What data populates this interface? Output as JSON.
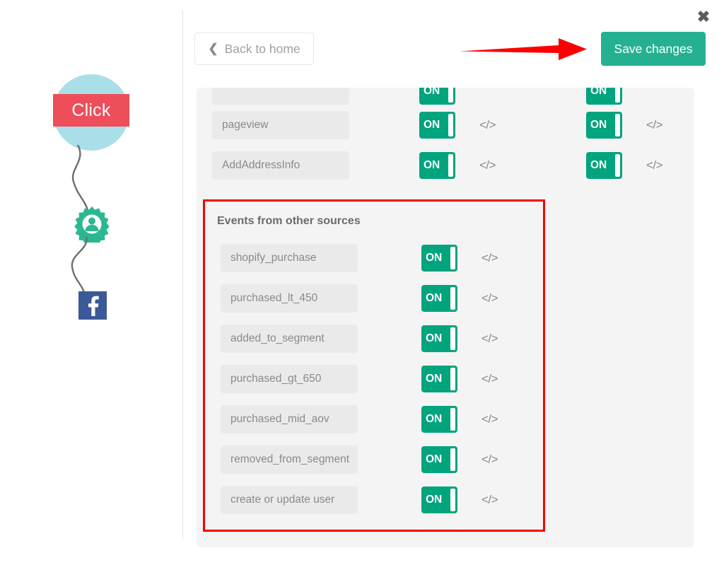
{
  "toolbar": {
    "back_label": "Back to home",
    "back_icon": "chevron-left-icon",
    "save_label": "Save changes",
    "close_label": "✖",
    "save_color": "#25b191",
    "arrow_color": "#fb0000"
  },
  "illustration": {
    "click_label": "Click",
    "circle_color": "#a9dfe8",
    "banner_color": "#ee4d5a",
    "gear_icon": "gear-user-icon",
    "gear_color": "#2bb792",
    "facebook_icon": "facebook-icon",
    "facebook_color": "#3b5998"
  },
  "panel": {
    "highlight_color": "#fb0000",
    "toggle_on_color": "#02a47d",
    "code_icon_glyph": "</>",
    "toggle_on_label": "ON",
    "standard_events": [
      {
        "name": "",
        "pixel_toggle": "ON",
        "conversion_toggle": "ON"
      },
      {
        "name": "pageview",
        "pixel_toggle": "ON",
        "conversion_toggle": "ON"
      },
      {
        "name": "AddAddressInfo",
        "pixel_toggle": "ON",
        "conversion_toggle": "ON"
      }
    ],
    "other_sources": {
      "title": "Events from other sources",
      "events": [
        {
          "name": "shopify_purchase",
          "toggle": "ON"
        },
        {
          "name": "purchased_lt_450",
          "toggle": "ON"
        },
        {
          "name": "added_to_segment",
          "toggle": "ON"
        },
        {
          "name": "purchased_gt_650",
          "toggle": "ON"
        },
        {
          "name": "purchased_mid_aov",
          "toggle": "ON"
        },
        {
          "name": "removed_from_segment",
          "toggle": "ON"
        },
        {
          "name": "create or update user",
          "toggle": "ON"
        }
      ]
    }
  }
}
